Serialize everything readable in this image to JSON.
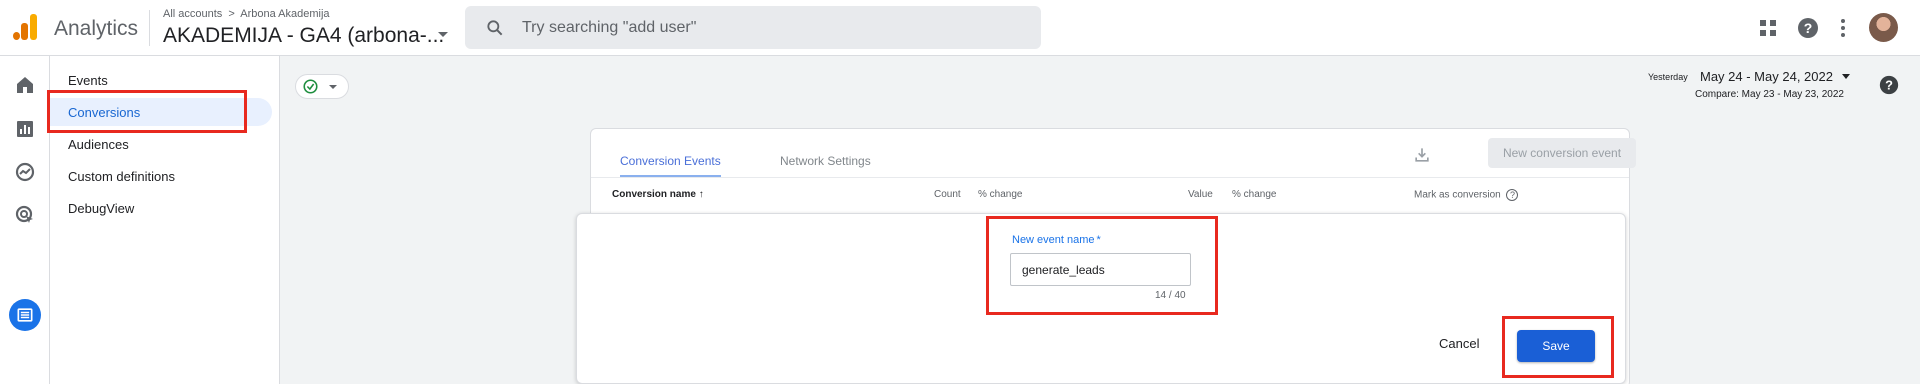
{
  "header": {
    "app_name": "Analytics",
    "breadcrumb_root": "All accounts",
    "breadcrumb_sep": ">",
    "breadcrumb_account": "Arbona Akademija",
    "property_name": "AKADEMIJA - GA4 (arbona-...",
    "search_placeholder": "Try searching \"add user\"",
    "icons": [
      "apps-icon",
      "help-icon",
      "more-vert-icon"
    ]
  },
  "rail": {
    "icons": [
      "home-icon",
      "reports-icon",
      "explore-icon",
      "advertising-icon",
      "configure-icon"
    ]
  },
  "subnav": {
    "items": [
      {
        "label": "Events"
      },
      {
        "label": "Conversions"
      },
      {
        "label": "Audiences"
      },
      {
        "label": "Custom definitions"
      },
      {
        "label": "DebugView"
      }
    ],
    "active": "Conversions"
  },
  "date": {
    "label": "Yesterday",
    "range": "May 24 - May 24, 2022",
    "compare": "Compare: May 23 - May 23, 2022"
  },
  "card": {
    "tabs": [
      "Conversion Events",
      "Network Settings"
    ],
    "new_button": "New conversion event",
    "columns": [
      "Conversion name",
      "Count",
      "% change",
      "Value",
      "% change",
      "Mark as conversion"
    ],
    "sort_arrow": "↑",
    "help_glyph": "?"
  },
  "dialog": {
    "field_label": "New event name",
    "required_mark": "*",
    "field_value": "generate_leads",
    "char_count": "14 / 40",
    "cancel_label": "Cancel",
    "save_label": "Save"
  },
  "colors": {
    "accent": "#1a73e8",
    "highlight": "#e8291f",
    "logo_dark": "#e37400",
    "logo_light": "#f9ab00"
  }
}
